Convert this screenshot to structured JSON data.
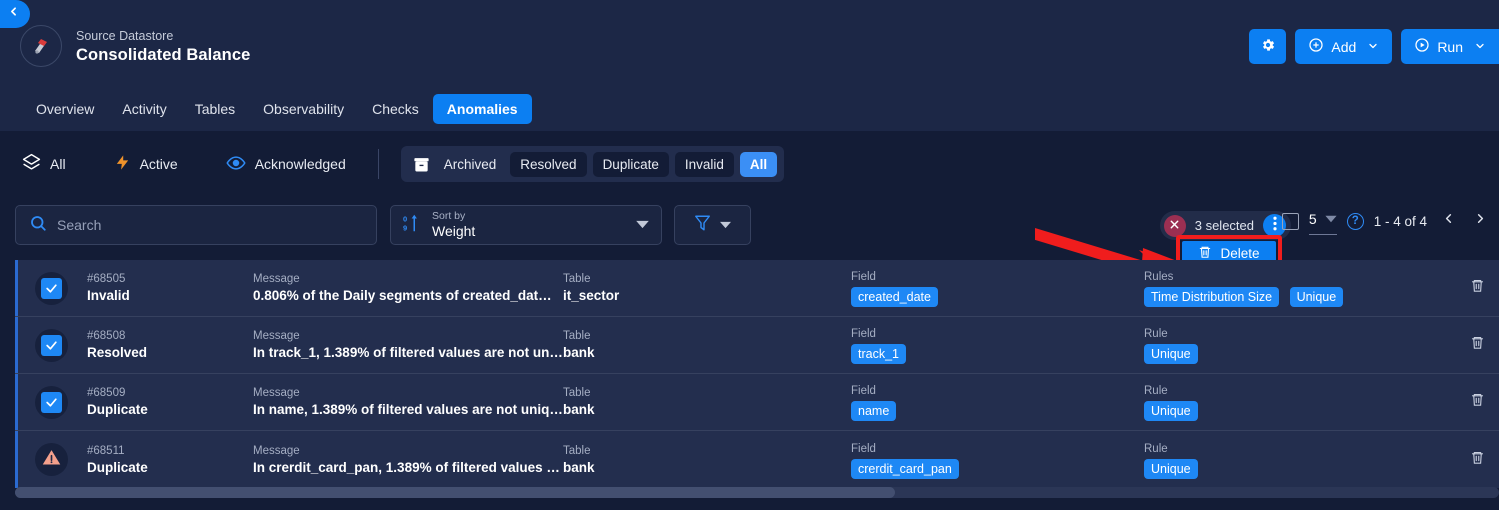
{
  "header": {
    "back_icon": "chevron-left-icon",
    "subtitle": "Source Datastore",
    "title": "Consolidated Balance",
    "logo_icon": "datastore-logo-icon",
    "actions": {
      "settings_icon": "gear-icon",
      "add_label": "Add",
      "add_icon": "plus-circle-icon",
      "run_label": "Run",
      "run_icon": "play-circle-icon",
      "caret_icon": "chevron-down-icon"
    }
  },
  "tabs": [
    {
      "label": "Overview",
      "active": false
    },
    {
      "label": "Activity",
      "active": false
    },
    {
      "label": "Tables",
      "active": false
    },
    {
      "label": "Observability",
      "active": false
    },
    {
      "label": "Checks",
      "active": false
    },
    {
      "label": "Anomalies",
      "active": true
    }
  ],
  "filterbar": {
    "groups": [
      {
        "label": "All",
        "icon": "layers-icon"
      },
      {
        "label": "Active",
        "icon": "lightning-icon"
      },
      {
        "label": "Acknowledged",
        "icon": "eye-icon"
      }
    ],
    "segment_icon": "archive-icon",
    "segment_label": "Archived",
    "segments": [
      {
        "label": "Resolved",
        "state": "dark"
      },
      {
        "label": "Duplicate",
        "state": "dark"
      },
      {
        "label": "Invalid",
        "state": "dark"
      },
      {
        "label": "All",
        "state": "active"
      }
    ]
  },
  "search": {
    "placeholder": "Search",
    "value": "",
    "icon": "search-icon"
  },
  "sort": {
    "icon": "sort-numeric-icon",
    "label": "Sort by",
    "value": "Weight",
    "caret_icon": "caret-down-icon"
  },
  "filter_button": {
    "icon": "funnel-icon",
    "caret_icon": "caret-down-icon"
  },
  "selection": {
    "clear_icon": "close-icon",
    "count_label": "3 selected",
    "kebab_icon": "more-vertical-icon"
  },
  "pagination": {
    "select_all_icon": "checkbox-empty-icon",
    "page_size": "5",
    "caret_icon": "caret-down-icon",
    "help_icon": "question-icon",
    "help_glyph": "?",
    "range_label": "1 - 4 of 4",
    "prev_icon": "chevron-left-icon",
    "next_icon": "chevron-right-icon"
  },
  "delete_popup": {
    "label": "Delete",
    "icon": "trash-icon"
  },
  "table": {
    "labels": {
      "message": "Message",
      "table": "Table",
      "field": "Field",
      "rules_plural": "Rules",
      "rule_singular": "Rule"
    },
    "row_trash_icon": "trash-icon",
    "rows": [
      {
        "id": "#68505",
        "status": "Invalid",
        "selected": true,
        "state_icon": "checkbox-checked-icon",
        "message": "0.806% of the Daily segments of created_dat…",
        "table": "it_sector",
        "field_label": "Field",
        "fields": [
          "created_date"
        ],
        "rule_label": "Rules",
        "rules": [
          "Time Distribution Size",
          "Unique"
        ]
      },
      {
        "id": "#68508",
        "status": "Resolved",
        "selected": true,
        "state_icon": "checkbox-checked-icon",
        "message": "In track_1, 1.389% of filtered values are not uni…",
        "table": "bank",
        "field_label": "Field",
        "fields": [
          "track_1"
        ],
        "rule_label": "Rule",
        "rules": [
          "Unique"
        ]
      },
      {
        "id": "#68509",
        "status": "Duplicate",
        "selected": true,
        "state_icon": "checkbox-checked-icon",
        "message": "In name, 1.389% of filtered values are not uniq…",
        "table": "bank",
        "field_label": "Field",
        "fields": [
          "name"
        ],
        "rule_label": "Rule",
        "rules": [
          "Unique"
        ]
      },
      {
        "id": "#68511",
        "status": "Duplicate",
        "selected": false,
        "state_icon": "warning-triangle-icon",
        "message": "In crerdit_card_pan, 1.389% of filtered values …",
        "table": "bank",
        "field_label": "Field",
        "fields": [
          "crerdit_card_pan"
        ],
        "rule_label": "Rule",
        "rules": [
          "Unique"
        ]
      }
    ]
  },
  "colors": {
    "accent": "#0c7ff2",
    "page_bg": "#131c36",
    "panel_bg": "#1c2746",
    "row_bg": "#232e4e",
    "chip": "#1e88f5",
    "highlight_red": "#f01d1d",
    "warning": "#f9a28a",
    "clear_pill": "#9b2f52"
  }
}
